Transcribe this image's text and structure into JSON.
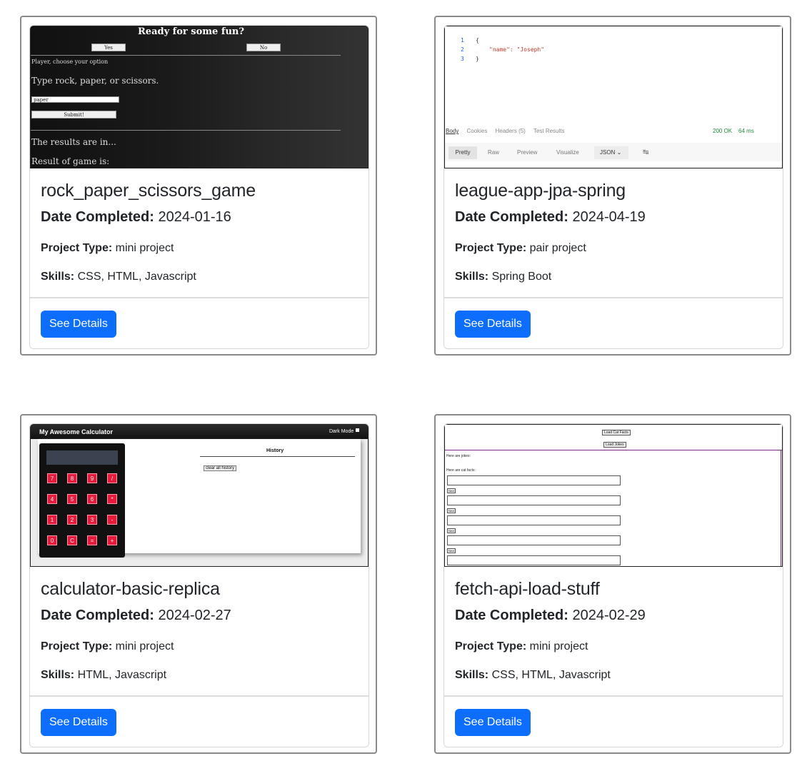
{
  "cards": [
    {
      "title": "rock_paper_scissors_game",
      "date_label": "Date Completed:",
      "date": "2024-01-16",
      "type_label": "Project Type:",
      "type": "mini project",
      "skills_label": "Skills:",
      "skills": "CSS, HTML, Javascript",
      "button": "See Details",
      "thumb": {
        "heading": "Ready for some fun?",
        "yes": "Yes",
        "no": "No",
        "choose": "Player, choose your option",
        "prompt": "Type rock, paper, or scissors.",
        "input_value": "paper",
        "submit": "Submit!",
        "results": "The results are in...",
        "result_line": "Result of game is:"
      }
    },
    {
      "title": "league-app-jpa-spring",
      "date_label": "Date Completed:",
      "date": "2024-04-19",
      "type_label": "Project Type:",
      "type": "pair project",
      "skills_label": "Skills:",
      "skills": "Spring Boot",
      "button": "See Details",
      "thumb": {
        "line_numbers": [
          "1",
          "2",
          "3"
        ],
        "code_lines": [
          "{",
          "\"name\": \"Joseph\"",
          "}"
        ],
        "tabs": [
          "Body",
          "Cookies",
          "Headers (5)",
          "Test Results"
        ],
        "status": "200 OK",
        "time": "64 ms",
        "views": [
          "Pretty",
          "Raw",
          "Preview",
          "Visualize"
        ],
        "format": "JSON"
      }
    },
    {
      "title": "calculator-basic-replica",
      "date_label": "Date Completed:",
      "date": "2024-02-27",
      "type_label": "Project Type:",
      "type": "mini project",
      "skills_label": "Skills:",
      "skills": "HTML, Javascript",
      "button": "See Details",
      "thumb": {
        "app_title": "My Awesome Calculator",
        "dark_mode": "Dark Mode",
        "keys": [
          "7",
          "8",
          "9",
          "/",
          "4",
          "5",
          "6",
          "*",
          "1",
          "2",
          "3",
          "-",
          "0",
          "C",
          "=",
          "+"
        ],
        "history": "History",
        "clear_history": "clear all history"
      }
    },
    {
      "title": "fetch-api-load-stuff",
      "date_label": "Date Completed:",
      "date": "2024-02-29",
      "type_label": "Project Type:",
      "type": "mini project",
      "skills_label": "Skills:",
      "skills": "CSS, HTML, Javascript",
      "button": "See Details",
      "thumb": {
        "load_facts": "Load Cat Facts",
        "load_jokes": "Load Jokes",
        "jokes_label": "Here are jokes:",
        "facts_label": "Here are cat facts:",
        "mini_button": "Next"
      }
    }
  ]
}
